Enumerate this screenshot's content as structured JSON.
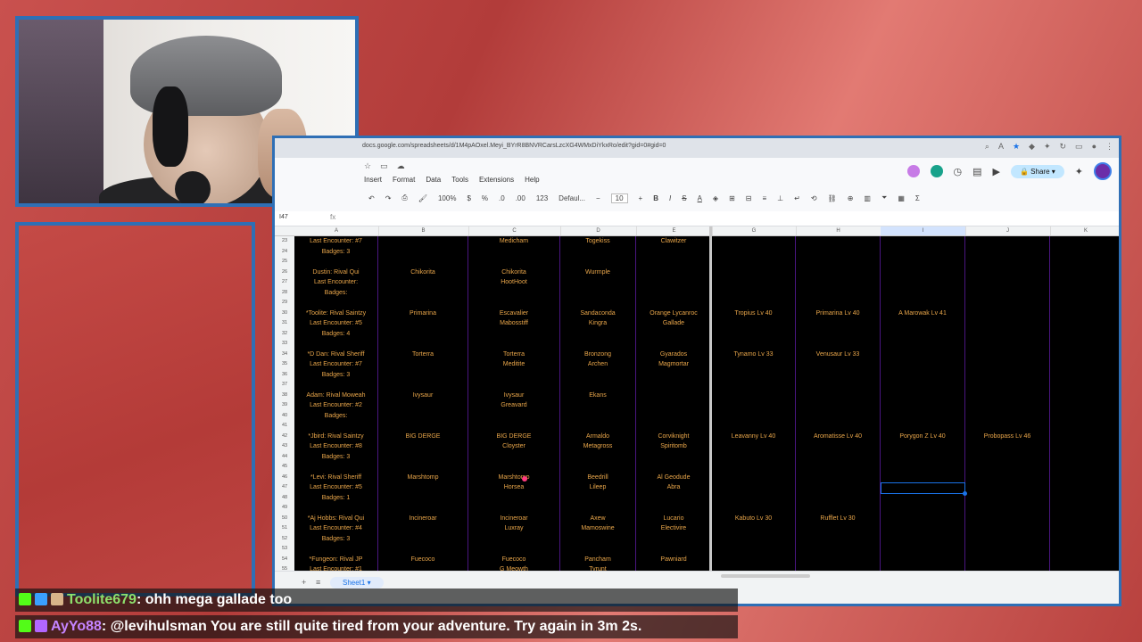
{
  "browser": {
    "url": "docs.google.com/spreadsheets/d/1M4pAOxel.Meyi_BYrR8BNVRCarsLzcXG4WMxDiYkxRo/edit?gid=0#gid=0"
  },
  "menus": {
    "top": [
      "Insert",
      "Format",
      "Data",
      "Tools",
      "Extensions",
      "Help"
    ]
  },
  "toolbar": {
    "zoom": "100%",
    "currency": "$",
    "percent": "%",
    "decimal_dec": ".0",
    "decimal_inc": ".00",
    "format_123": "123",
    "font": "Defaul...",
    "font_size": "10",
    "bold": "B",
    "italic": "I",
    "strike": "S",
    "text_color": "A"
  },
  "formula_bar": {
    "cell_ref": "I47",
    "fx": "fx"
  },
  "share_label": "Share",
  "columns": [
    "A",
    "B",
    "C",
    "D",
    "E",
    "G",
    "H",
    "I",
    "J",
    "K"
  ],
  "rows": [
    {
      "n": "23",
      "cells": [
        "Last Encounter: #7",
        "",
        "Medicham",
        "Togekiss",
        "Clawitzer",
        "",
        "",
        "",
        "",
        ""
      ]
    },
    {
      "n": "24",
      "cells": [
        "Badges: 3",
        "",
        "",
        "",
        "",
        "",
        "",
        "",
        "",
        ""
      ]
    },
    {
      "n": "25",
      "cells": [
        "",
        "",
        "",
        "",
        "",
        "",
        "",
        "",
        "",
        ""
      ]
    },
    {
      "n": "26",
      "cells": [
        "Dustin: Rival Qui",
        "Chikorita",
        "Chikorita",
        "Wurmple",
        "",
        "",
        "",
        "",
        "",
        ""
      ]
    },
    {
      "n": "27",
      "cells": [
        "Last Encounter:",
        "",
        "HootHoot",
        "",
        "",
        "",
        "",
        "",
        "",
        ""
      ]
    },
    {
      "n": "28",
      "cells": [
        "Badges:",
        "",
        "",
        "",
        "",
        "",
        "",
        "",
        "",
        ""
      ]
    },
    {
      "n": "29",
      "cells": [
        "",
        "",
        "",
        "",
        "",
        "",
        "",
        "",
        "",
        ""
      ]
    },
    {
      "n": "30",
      "cells": [
        "*Toolite: Rival Saintzy",
        "Primarina",
        "Escavalier",
        "Sandaconda",
        "Orange Lycanroc",
        "Tropius Lv 40",
        "Primarina Lv 40",
        "A Marowak Lv 41",
        "",
        ""
      ]
    },
    {
      "n": "31",
      "cells": [
        "Last Encounter: #5",
        "",
        "Mabosstiff",
        "Kingra",
        "Gallade",
        "",
        "",
        "",
        "",
        ""
      ]
    },
    {
      "n": "32",
      "cells": [
        "Badges: 4",
        "",
        "",
        "",
        "",
        "",
        "",
        "",
        "",
        ""
      ]
    },
    {
      "n": "33",
      "cells": [
        "",
        "",
        "",
        "",
        "",
        "",
        "",
        "",
        "",
        ""
      ]
    },
    {
      "n": "34",
      "cells": [
        "*D Dan: Rival Sheriff",
        "Torterra",
        "Torterra",
        "Bronzong",
        "Gyarados",
        "Tynamo Lv 33",
        "Venusaur Lv 33",
        "",
        "",
        ""
      ]
    },
    {
      "n": "35",
      "cells": [
        "Last Encounter: #7",
        "",
        "Meditite",
        "Archen",
        "Magmortar",
        "",
        "",
        "",
        "",
        ""
      ]
    },
    {
      "n": "36",
      "cells": [
        "Badges: 3",
        "",
        "",
        "",
        "",
        "",
        "",
        "",
        "",
        ""
      ]
    },
    {
      "n": "37",
      "cells": [
        "",
        "",
        "",
        "",
        "",
        "",
        "",
        "",
        "",
        ""
      ]
    },
    {
      "n": "38",
      "cells": [
        "Adam: Rival Moweah",
        "Ivysaur",
        "Ivysaur",
        "Ekans",
        "",
        "",
        "",
        "",
        "",
        ""
      ]
    },
    {
      "n": "39",
      "cells": [
        "Last Encounter: #2",
        "",
        "Greavard",
        "",
        "",
        "",
        "",
        "",
        "",
        ""
      ]
    },
    {
      "n": "40",
      "cells": [
        "Badges:",
        "",
        "",
        "",
        "",
        "",
        "",
        "",
        "",
        ""
      ]
    },
    {
      "n": "41",
      "cells": [
        "",
        "",
        "",
        "",
        "",
        "",
        "",
        "",
        "",
        ""
      ]
    },
    {
      "n": "42",
      "cells": [
        "*Jbird: Rival Saintzy",
        "BIG DERGE",
        "BIG DERGE",
        "Armaldo",
        "Corviknight",
        "Leavanny Lv 40",
        "Aromatisse Lv 40",
        "Porygon Z Lv 40",
        "Probopass Lv 46",
        ""
      ]
    },
    {
      "n": "43",
      "cells": [
        "Last Encounter: #8",
        "",
        "Cloyster",
        "Metagross",
        "Spiritomb",
        "",
        "",
        "",
        "",
        ""
      ]
    },
    {
      "n": "44",
      "cells": [
        "Badges: 3",
        "",
        "",
        "",
        "",
        "",
        "",
        "",
        "",
        ""
      ]
    },
    {
      "n": "45",
      "cells": [
        "",
        "",
        "",
        "",
        "",
        "",
        "",
        "",
        "",
        ""
      ]
    },
    {
      "n": "46",
      "cells": [
        "*Levi: Rival Sheriff",
        "Marshtomp",
        "Marshtomp",
        "Beedrill",
        "Al Geodude",
        "",
        "",
        "",
        "",
        ""
      ]
    },
    {
      "n": "47",
      "cells": [
        "Last Encounter: #5",
        "",
        "Horsea",
        "Lileep",
        "Abra",
        "",
        "",
        "",
        "",
        ""
      ]
    },
    {
      "n": "48",
      "cells": [
        "Badges: 1",
        "",
        "",
        "",
        "",
        "",
        "",
        "",
        "",
        ""
      ]
    },
    {
      "n": "49",
      "cells": [
        "",
        "",
        "",
        "",
        "",
        "",
        "",
        "",
        "",
        ""
      ]
    },
    {
      "n": "50",
      "cells": [
        "*Aj Hobbs: Rival Qui",
        "Incineroar",
        "Incineroar",
        "Axew",
        "Lucario",
        "Kabuto Lv 30",
        "Rufflet Lv 30",
        "",
        "",
        ""
      ]
    },
    {
      "n": "51",
      "cells": [
        "Last Encounter: #4",
        "",
        "Luxray",
        "Mamoswine",
        "Electivire",
        "",
        "",
        "",
        "",
        ""
      ]
    },
    {
      "n": "52",
      "cells": [
        "Badges: 3",
        "",
        "",
        "",
        "",
        "",
        "",
        "",
        "",
        ""
      ]
    },
    {
      "n": "53",
      "cells": [
        "",
        "",
        "",
        "",
        "",
        "",
        "",
        "",
        "",
        ""
      ]
    },
    {
      "n": "54",
      "cells": [
        "*Fungeon: Rival JP",
        "Fuecoco",
        "Fuecoco",
        "Pancham",
        "Pawniard",
        "",
        "",
        "",
        "",
        ""
      ]
    },
    {
      "n": "55",
      "cells": [
        "Last Encounter: #1",
        "",
        "G Meowth",
        "Tyrunt",
        "",
        "",
        "",
        "",
        "",
        ""
      ]
    }
  ],
  "sheet_tab": "Sheet1",
  "chat": [
    {
      "user": "Toolite679",
      "message": ": ohh mega gallade too"
    },
    {
      "user": "AyYo88",
      "message": ": @levihulsman You are still quite tired from your adventure. Try again in 3m 2s."
    }
  ],
  "colors": {
    "cell_text": "#e9a64a",
    "grid_line": "#4a1680",
    "frame": "#2f6fb5"
  }
}
